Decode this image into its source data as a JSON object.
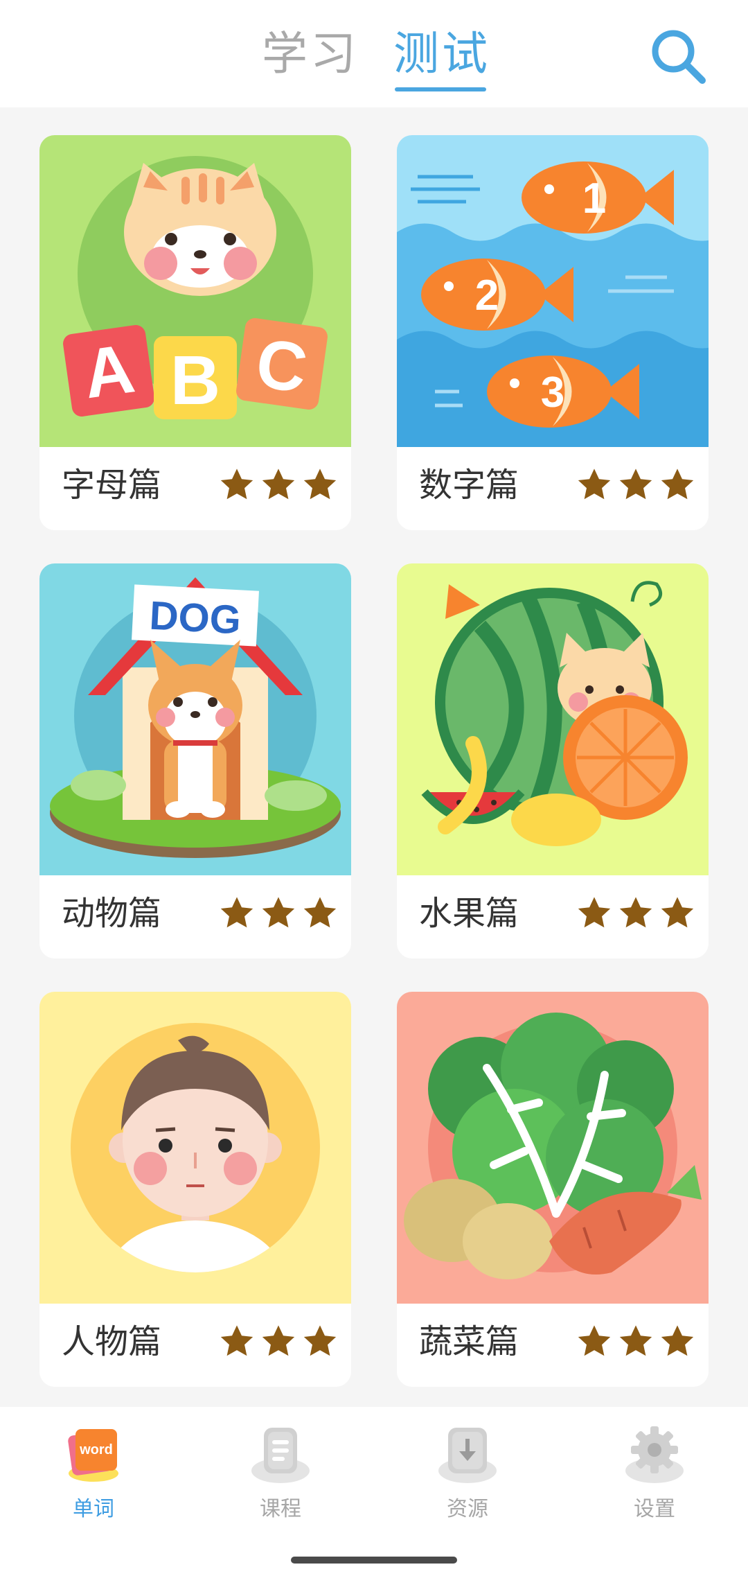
{
  "header": {
    "tabs": [
      {
        "label": "学习",
        "active": false
      },
      {
        "label": "测试",
        "active": true
      }
    ],
    "search_icon": "search-icon"
  },
  "cards": [
    {
      "label": "字母篇",
      "stars": 3,
      "image": "cat-with-abc-blocks",
      "bg": "#b5e477",
      "badge_text": [
        "A",
        "B",
        "C"
      ]
    },
    {
      "label": "数字篇",
      "stars": 3,
      "image": "numbered-fish",
      "bg": "#4fb3e8",
      "badge_text": [
        "1",
        "2",
        "3"
      ]
    },
    {
      "label": "动物篇",
      "stars": 3,
      "image": "dog-in-doghouse",
      "bg": "#80d8e4",
      "badge_text": [
        "DOG"
      ]
    },
    {
      "label": "水果篇",
      "stars": 3,
      "image": "cat-with-fruits",
      "bg": "#e8fb90"
    },
    {
      "label": "人物篇",
      "stars": 3,
      "image": "boy-portrait",
      "bg": "#fff09c"
    },
    {
      "label": "蔬菜篇",
      "stars": 3,
      "image": "vegetables",
      "bg": "#fbaa98"
    }
  ],
  "bottom_nav": [
    {
      "label": "单词",
      "icon": "word-icon",
      "active": true,
      "icon_text": "word"
    },
    {
      "label": "课程",
      "icon": "course-icon",
      "active": false
    },
    {
      "label": "资源",
      "icon": "download-icon",
      "active": false
    },
    {
      "label": "设置",
      "icon": "gear-icon",
      "active": false
    }
  ],
  "colors": {
    "accent": "#4aa6e0",
    "star": "#8b5a14",
    "inactive": "#a9a9a9"
  }
}
